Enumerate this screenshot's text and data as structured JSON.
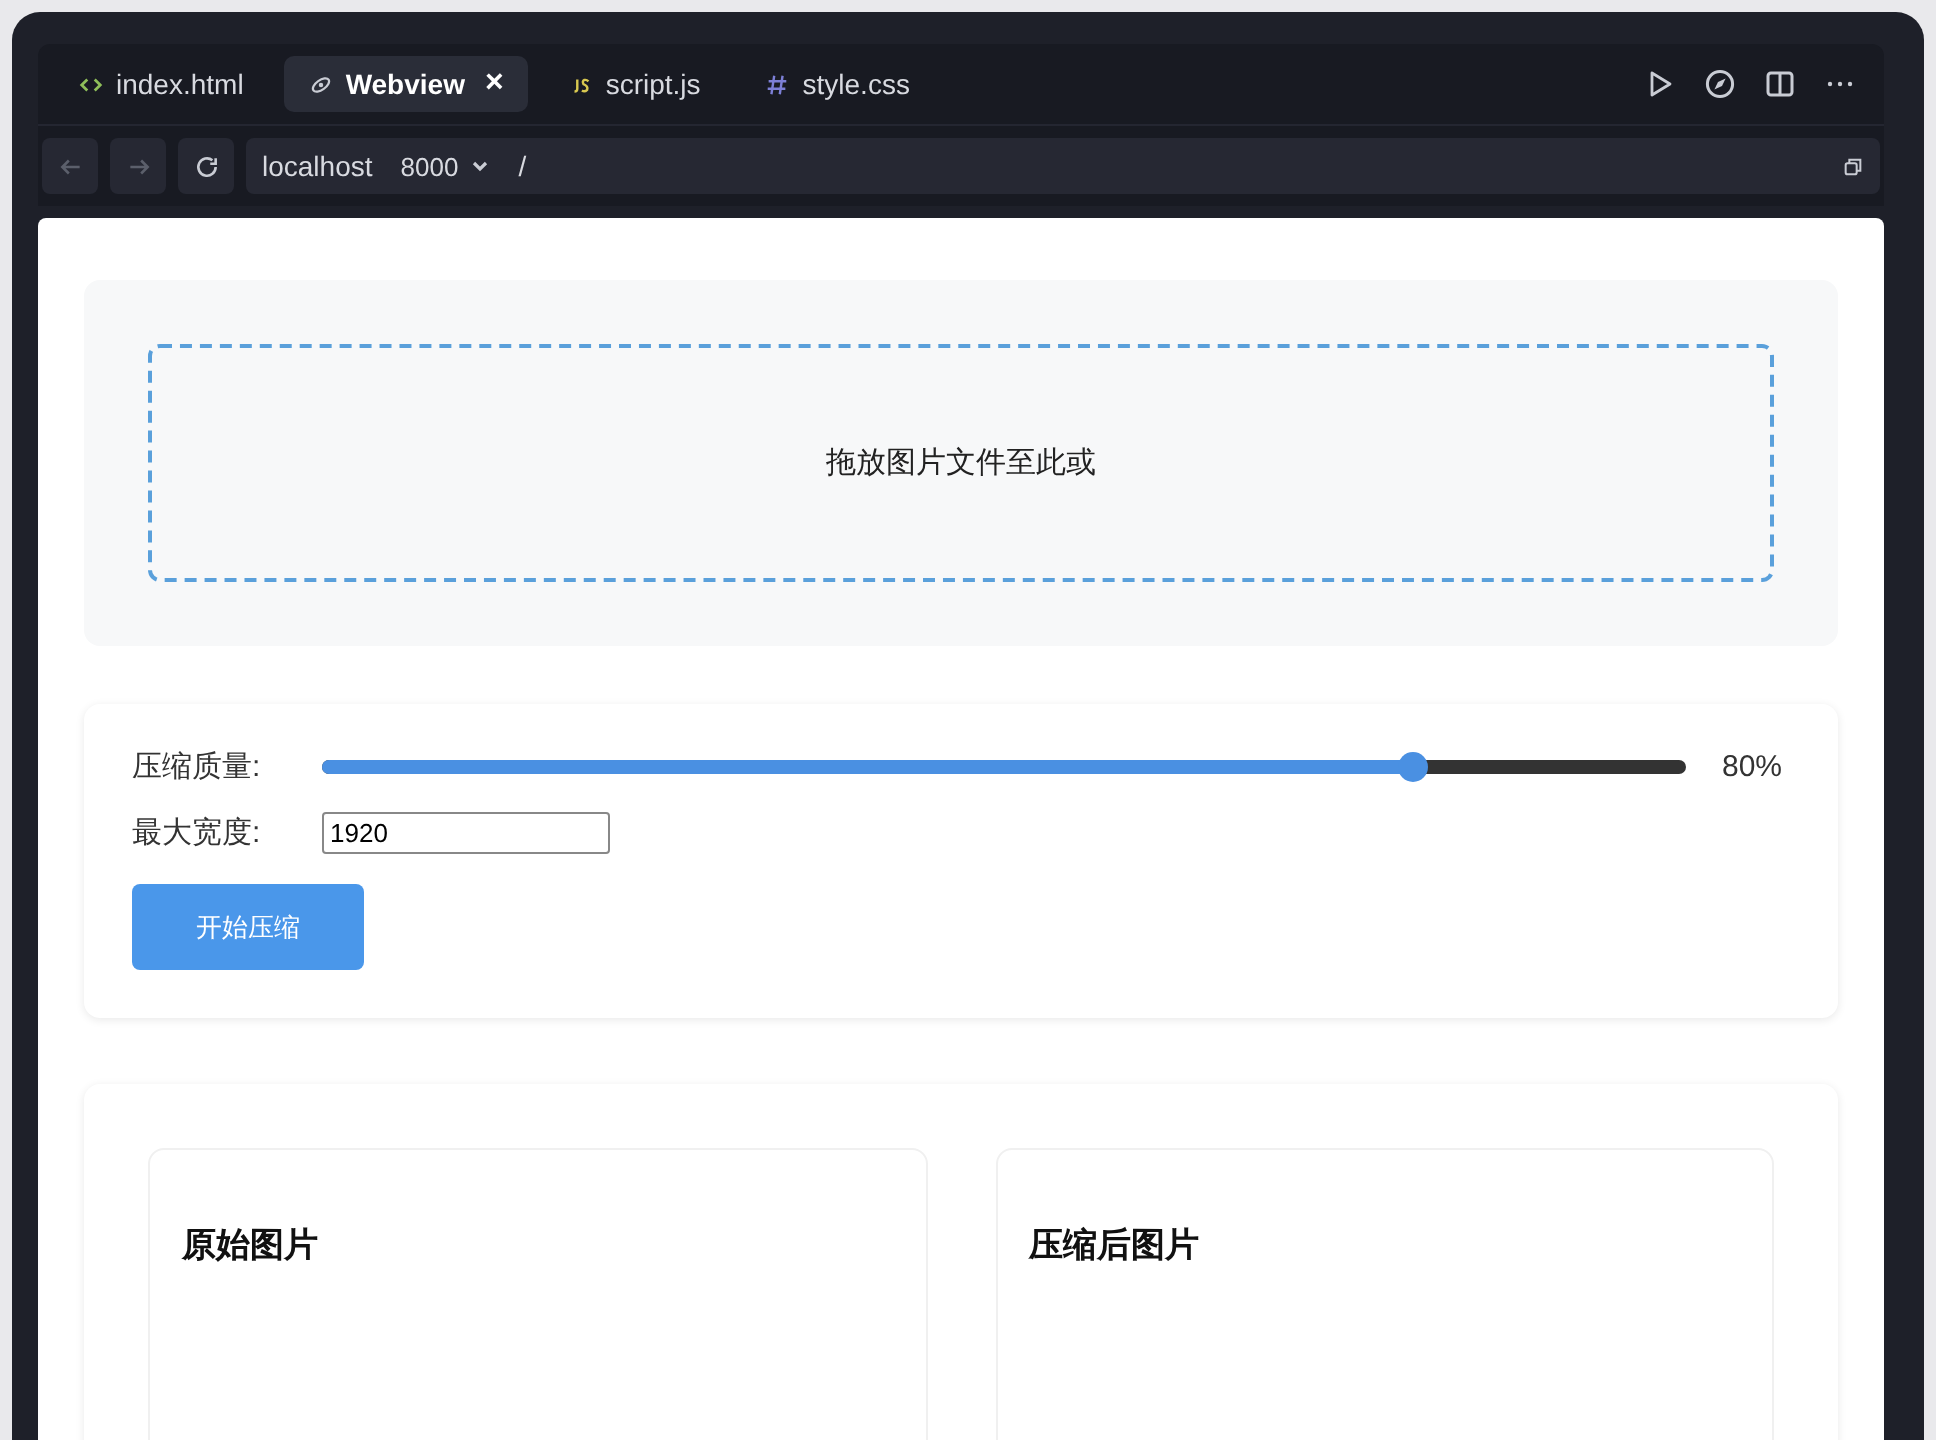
{
  "tabs": [
    {
      "kind": "html",
      "label": "index.html",
      "selected": false
    },
    {
      "kind": "webview",
      "label": "Webview",
      "selected": true,
      "close": "×"
    },
    {
      "kind": "js",
      "label": "script.js",
      "selected": false
    },
    {
      "kind": "css",
      "label": "style.css",
      "selected": false
    }
  ],
  "address": {
    "host": "localhost",
    "port": "8000",
    "path": "/"
  },
  "dropzone": {
    "text": "拖放图片文件至此或"
  },
  "settings": {
    "quality_label": "压缩质量:",
    "quality_slider": {
      "level": 0.8
    },
    "quality_reading": "80%",
    "width_label": "最大宽度:",
    "width_value": "1920",
    "button": "开始压缩"
  },
  "results": [
    {
      "title": "原始图片"
    },
    {
      "title": "压缩后图片"
    }
  ]
}
